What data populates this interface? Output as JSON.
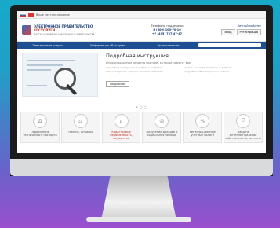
{
  "topbar": {
    "text": "Ваше местоположение"
  },
  "header": {
    "logo_title": "ЭЛЕКТРОННОЕ ПРАВИТЕЛЬСТВО",
    "logo_subtitle": "ГОСУСЛУГИ",
    "logo_caption": "Доступ к сервисам электронного правительства",
    "phones_title": "Телефоны поддержки",
    "phone1": "8 (800) 100-70-10",
    "phone2": "+7 (495) 727-47-47",
    "login_link": "Личный кабинет",
    "login_button": "Вход",
    "register_button": "Регистрация"
  },
  "nav": {
    "items": [
      "Электронные услуги",
      "Информация об услугах",
      "Органы власти"
    ]
  },
  "banner": {
    "title": "Подробная инструкция",
    "subtitle": "Информационные разделы портала, которые помогут вам",
    "list": [
      "подробная инструкция по работе с порталом",
      "список вопросов, которые помогут найти вам",
      "ответы на часто задаваемые вопросы",
      "подробнее об электронных услугах"
    ],
    "button": "Подробнее"
  },
  "categories": [
    {
      "icon": "doc-icon",
      "glyph": "Д",
      "label": "Оформление технического паспорта"
    },
    {
      "icon": "fine-icon",
      "glyph": "⚖",
      "label": "Налоги, штрафы"
    },
    {
      "icon": "realty-icon",
      "glyph": "⌂",
      "label": "Кадастровые недвижимость, имущество"
    },
    {
      "icon": "pension-icon",
      "glyph": "☺",
      "label": "Получение доходов и социальная помощь"
    },
    {
      "icon": "percent-icon",
      "glyph": "%",
      "label": "Регистрационные учетные налоги"
    },
    {
      "icon": "shield-icon",
      "glyph": "⛉",
      "label": "Защита интеллектуальной собственности, патенты"
    }
  ]
}
